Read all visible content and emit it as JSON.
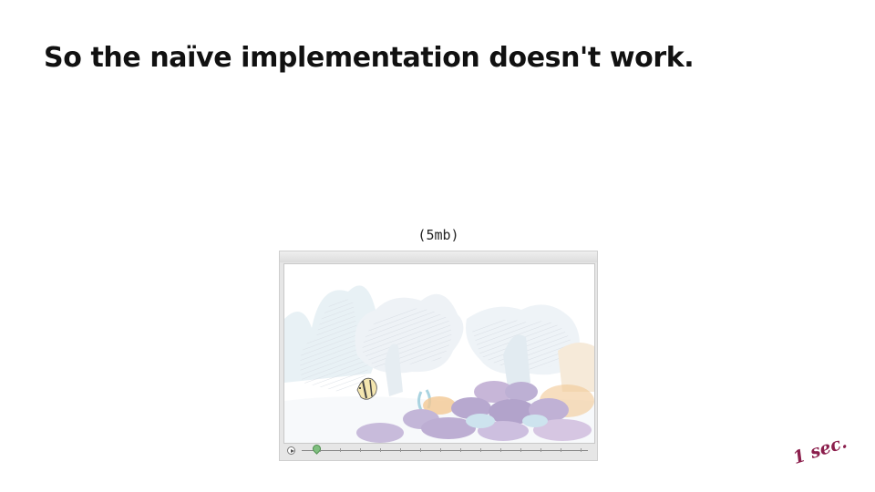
{
  "slide": {
    "title": "So the naïve implementation doesn't work.",
    "caption": "(5mb)",
    "duration_label": "1 sec."
  },
  "player": {
    "scene_description_icon": "underwater-coral-reef-animation",
    "controls": {
      "play_icon": "play-icon",
      "handle_icon": "timeline-handle-icon"
    }
  },
  "colors": {
    "title": "#111111",
    "duration_label": "#8b1e4c",
    "coral_purple": "#b7a8cf",
    "coral_orange": "#f2c894",
    "coral_blue": "#cde3ee",
    "handle": "#7fbf7f"
  }
}
